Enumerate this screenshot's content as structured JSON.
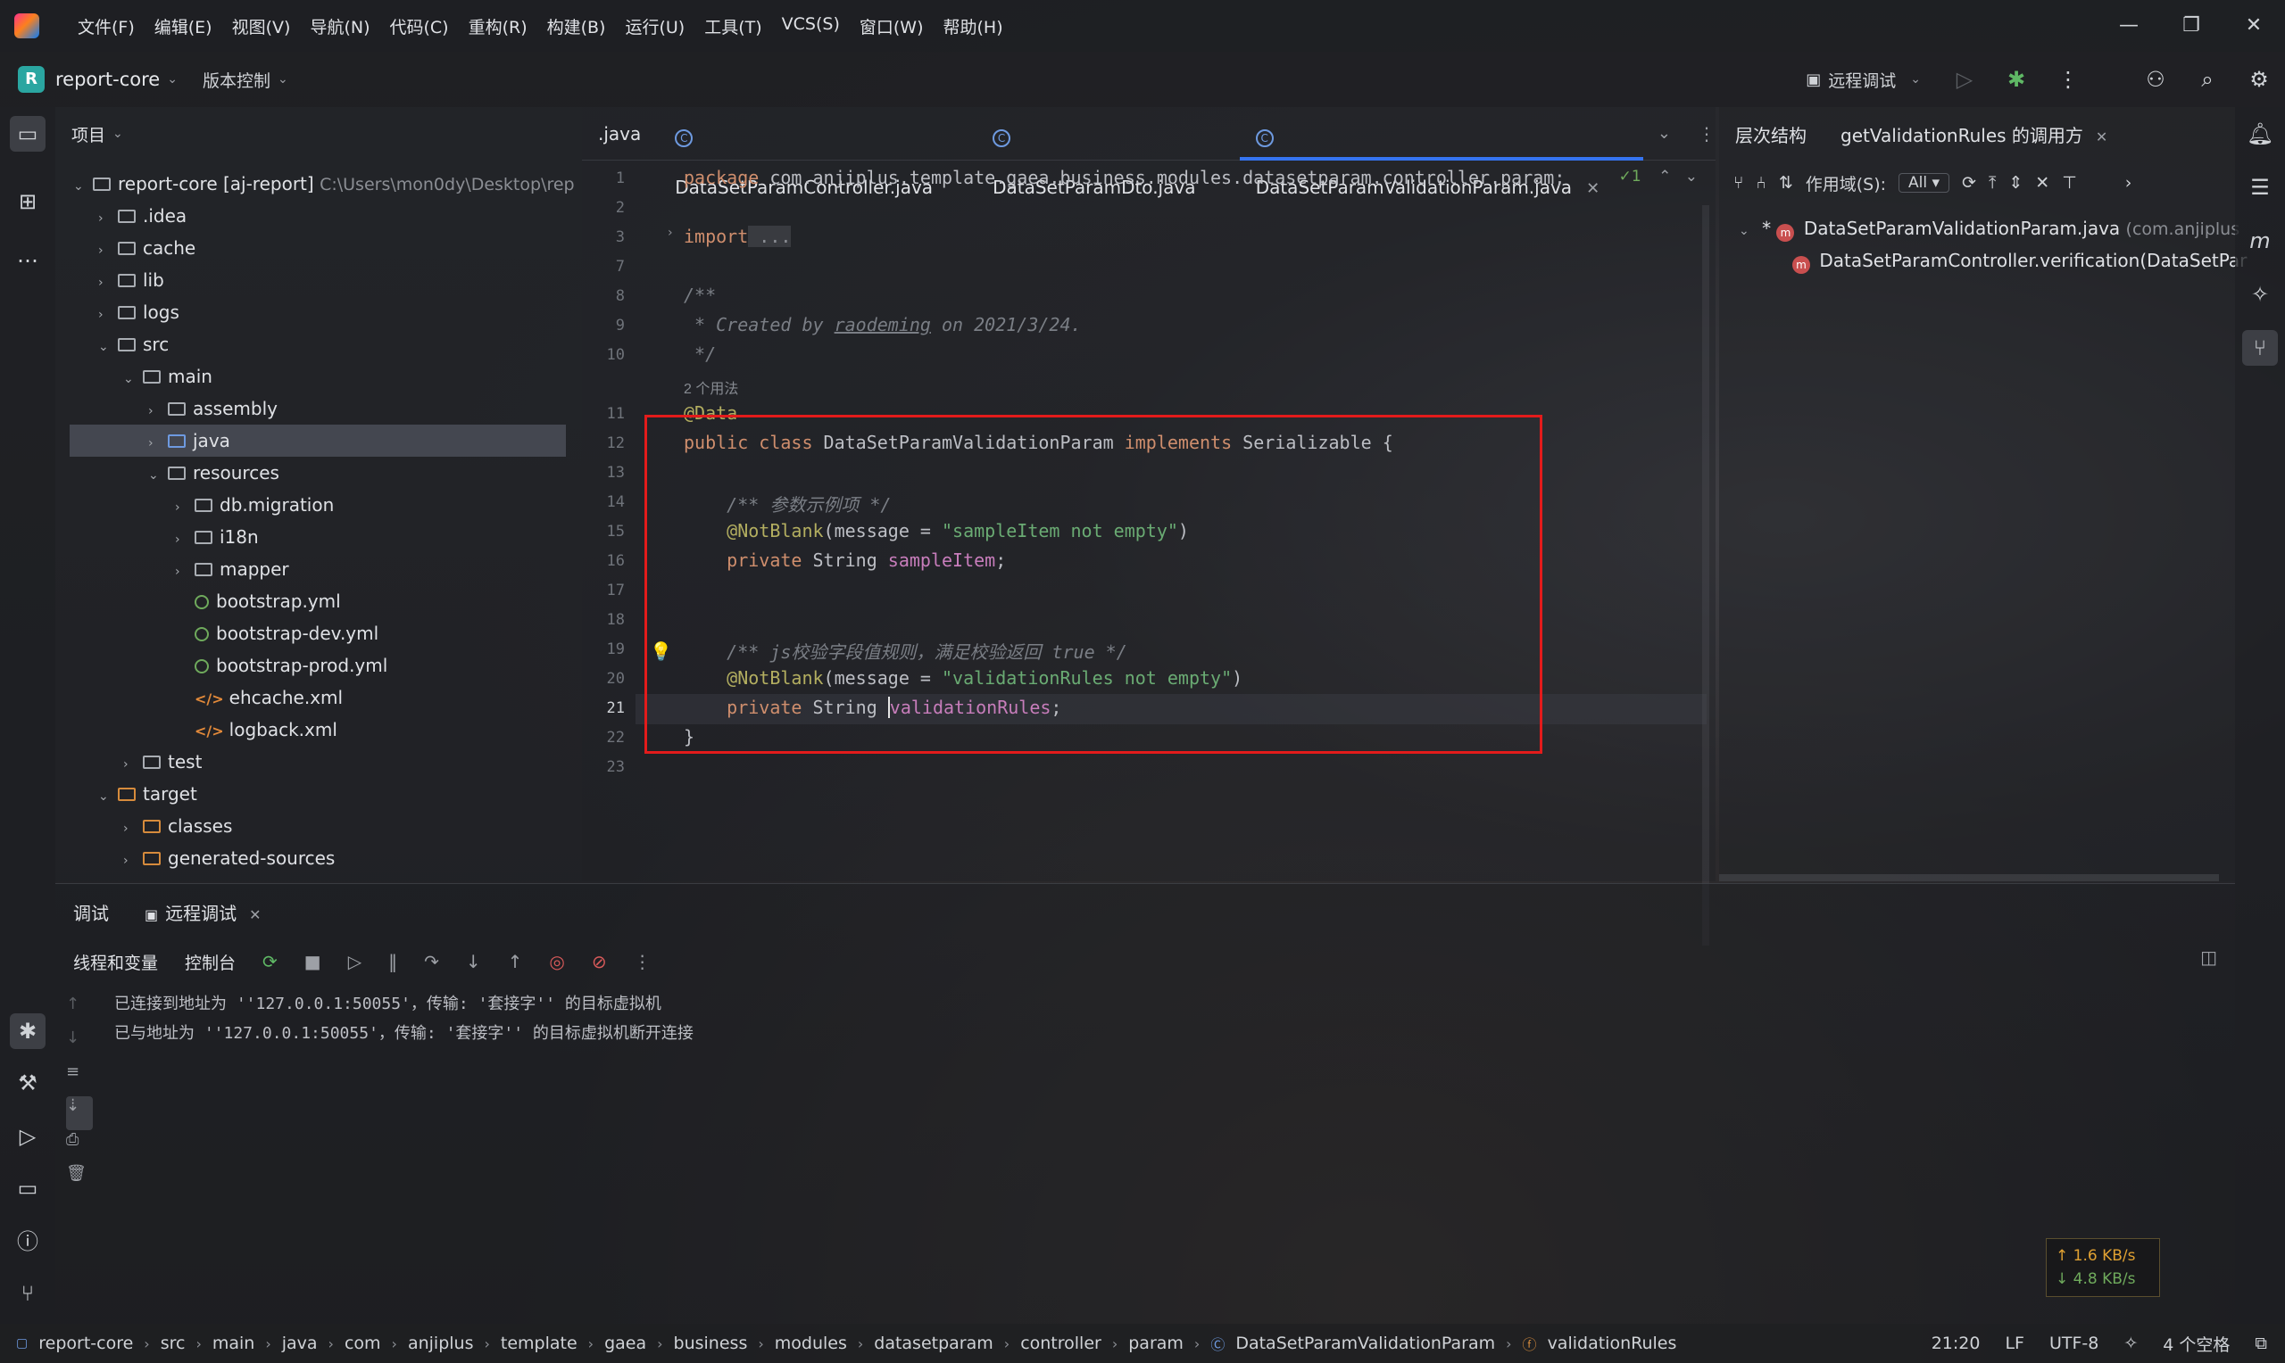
{
  "menu": [
    "文件(F)",
    "编辑(E)",
    "视图(V)",
    "导航(N)",
    "代码(C)",
    "重构(R)",
    "构建(B)",
    "运行(U)",
    "工具(T)",
    "VCS(S)",
    "窗口(W)",
    "帮助(H)"
  ],
  "window_controls": [
    "—",
    "❐",
    "✕"
  ],
  "toolbar": {
    "project_badge": "R",
    "project_name": "report-core",
    "vcs_label": "版本控制",
    "run_config": "远程调试"
  },
  "project_panel": {
    "title": "项目",
    "root_name": "report-core [aj-report]",
    "root_path": "C:\\Users\\mon0dy\\Desktop\\rep",
    "items": [
      {
        "label": ".idea"
      },
      {
        "label": "cache"
      },
      {
        "label": "lib"
      },
      {
        "label": "logs"
      },
      {
        "label": "src"
      },
      {
        "label": "main"
      },
      {
        "label": "assembly"
      },
      {
        "label": "java"
      },
      {
        "label": "resources"
      },
      {
        "label": "db.migration"
      },
      {
        "label": "i18n"
      },
      {
        "label": "mapper"
      },
      {
        "label": "bootstrap.yml"
      },
      {
        "label": "bootstrap-dev.yml"
      },
      {
        "label": "bootstrap-prod.yml"
      },
      {
        "label": "ehcache.xml"
      },
      {
        "label": "logback.xml"
      },
      {
        "label": "test"
      },
      {
        "label": "target"
      },
      {
        "label": "classes"
      },
      {
        "label": "generated-sources"
      }
    ]
  },
  "editor": {
    "tabs": [
      {
        "label": ".java"
      },
      {
        "label": "DataSetParamController.java"
      },
      {
        "label": "DataSetParamDto.java"
      },
      {
        "label": "DataSetParamValidationParam.java"
      }
    ],
    "inspection": "✓1",
    "line_numbers": [
      "1",
      "2",
      "3",
      "7",
      "8",
      "9",
      "10",
      "11",
      "12",
      "13",
      "14",
      "15",
      "16",
      "17",
      "18",
      "19",
      "20",
      "21",
      "22",
      "23"
    ],
    "code": {
      "package_kw": "package",
      "package_name": " com.anjiplus.template.gaea.business.modules.datasetparam.controller.param;",
      "import_kw": "import",
      "import_fold": " ...",
      "doc_open": "/**",
      "doc_created": " * Created by ",
      "doc_author": "raodeming",
      "doc_date": " on 2021/3/24.",
      "doc_close": " */",
      "usages": "2 个用法",
      "data_ann": "@Data",
      "class_mods": "public class",
      "class_name": " DataSetParamValidationParam ",
      "implements_kw": "implements",
      "class_rest": " Serializable {",
      "c1": "    /** 参数示例项 */",
      "ann1": "    @NotBlank",
      "ann1_open": "(message = ",
      "ann1_str": "\"sampleItem not empty\"",
      "ann1_close": ")",
      "f1_mods": "    private",
      "f1_type": " String ",
      "f1_name": "sampleItem",
      "f1_end": ";",
      "c2": "    /** js校验字段值规则，满足校验返回 true */",
      "ann2": "    @NotBlank",
      "ann2_open": "(message = ",
      "ann2_str": "\"validationRules not empty\"",
      "ann2_close": ")",
      "f2_mods": "    private",
      "f2_type": " String ",
      "f2_name": "validationRules",
      "f2_end": ";",
      "close": "}"
    }
  },
  "hierarchy": {
    "tab1": "层次结构",
    "tab2": "getValidationRules 的调用方",
    "scope_label": "作用域(S):",
    "scope_value": "All",
    "root": "DataSetParamValidationParam.java",
    "root_pkg": "(com.anjiplus",
    "child": "DataSetParamController.verification(DataSetPar"
  },
  "debug": {
    "tab1": "调试",
    "tab2": "远程调试",
    "sub1": "线程和变量",
    "sub2": "控制台",
    "lines": [
      "已连接到地址为 ''127.0.0.1:50055'，传输: '套接字'' 的目标虚拟机",
      "已与地址为 ''127.0.0.1:50055'，传输: '套接字'' 的目标虚拟机断开连接"
    ],
    "net_up": "↑ 1.6 KB/s",
    "net_down": "↓ 4.8 KB/s"
  },
  "statusbar": {
    "crumbs": [
      "report-core",
      "src",
      "main",
      "java",
      "com",
      "anjiplus",
      "template",
      "gaea",
      "business",
      "modules",
      "datasetparam",
      "controller",
      "param",
      "DataSetParamValidationParam",
      "validationRules"
    ],
    "position": "21:20",
    "line_sep": "LF",
    "encoding": "UTF-8",
    "indent": "4 个空格"
  }
}
